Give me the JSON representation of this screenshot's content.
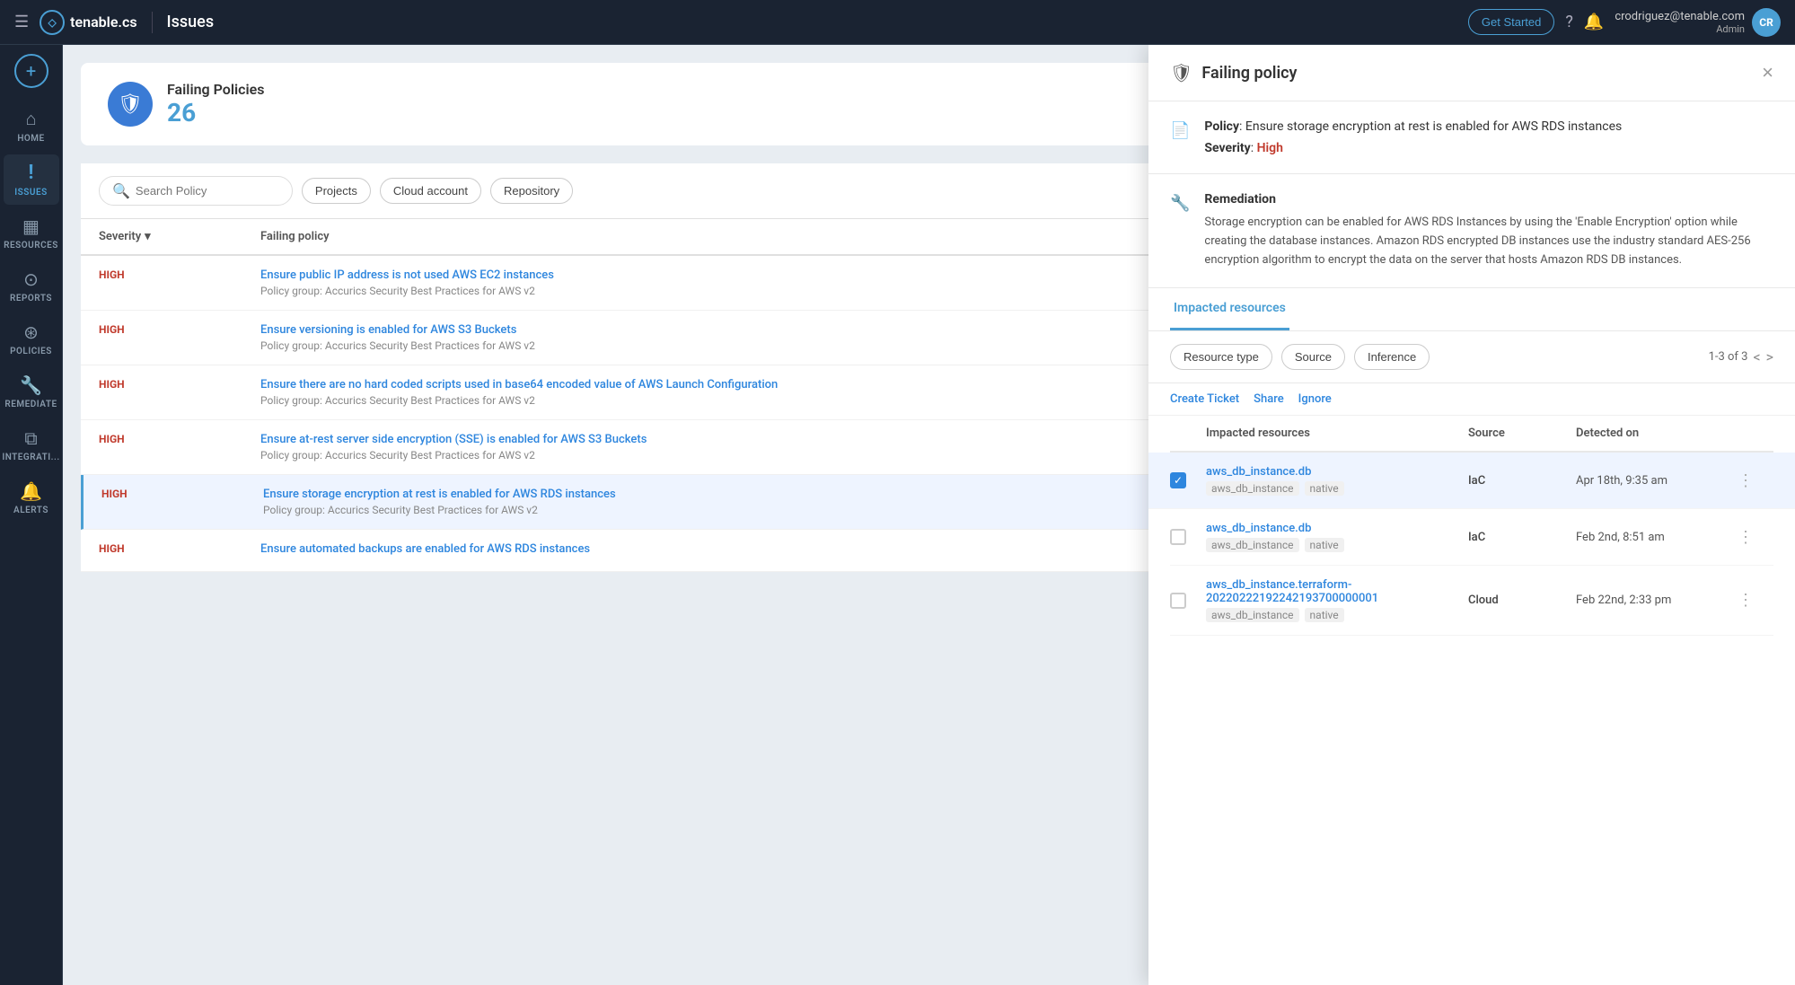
{
  "navbar": {
    "menu_icon": "☰",
    "logo_icon": "◇",
    "logo_text": "tenable.cs",
    "title": "Issues",
    "get_started": "Get Started",
    "help_icon": "?",
    "bell_icon": "🔔",
    "user_email": "crodriguez@tenable.com",
    "user_role": "Admin",
    "user_initials": "CR"
  },
  "sidebar": {
    "add_icon": "+",
    "items": [
      {
        "id": "home",
        "label": "HOME",
        "icon": "⌂",
        "active": false
      },
      {
        "id": "issues",
        "label": "ISSUES",
        "icon": "!",
        "active": true
      },
      {
        "id": "resources",
        "label": "RESOURCES",
        "icon": "▦",
        "active": false
      },
      {
        "id": "reports",
        "label": "REPORTS",
        "icon": "⊙",
        "active": false
      },
      {
        "id": "policies",
        "label": "POLICIES",
        "icon": "⊛",
        "active": false
      },
      {
        "id": "remediate",
        "label": "REMEDIATE",
        "icon": "🔧",
        "active": false
      },
      {
        "id": "integrations",
        "label": "INTEGRATI...",
        "icon": "⧉",
        "active": false
      },
      {
        "id": "alerts",
        "label": "ALERTS",
        "icon": "🔔",
        "active": false
      }
    ]
  },
  "issues": {
    "header": {
      "icon": "🛡",
      "title": "Failing Policies",
      "count": "26"
    },
    "toolbar": {
      "search_placeholder": "Search Policy",
      "filters": [
        "Projects",
        "Cloud account",
        "Repository"
      ]
    },
    "table_headers": {
      "severity": "Severity",
      "failing_policy": "Failing policy"
    },
    "rows": [
      {
        "severity": "HIGH",
        "policy": "Ensure public IP address is not used AWS EC2 instances",
        "group": "Policy group: Accurics Security Best Practices for AWS v2",
        "selected": false
      },
      {
        "severity": "HIGH",
        "policy": "Ensure versioning is enabled for AWS S3 Buckets",
        "group": "Policy group: Accurics Security Best Practices for AWS v2",
        "selected": false
      },
      {
        "severity": "HIGH",
        "policy": "Ensure there are no hard coded scripts used in base64 encoded value of AWS Launch Configuration",
        "group": "Policy group: Accurics Security Best Practices for AWS v2",
        "selected": false
      },
      {
        "severity": "HIGH",
        "policy": "Ensure at-rest server side encryption (SSE) is enabled for AWS S3 Buckets",
        "group": "Policy group: Accurics Security Best Practices for AWS v2",
        "selected": false
      },
      {
        "severity": "HIGH",
        "policy": "Ensure storage encryption at rest is enabled for AWS RDS instances",
        "group": "Policy group: Accurics Security Best Practices for AWS v2",
        "selected": true
      },
      {
        "severity": "HIGH",
        "policy": "Ensure automated backups are enabled for AWS RDS instances",
        "group": "",
        "selected": false
      }
    ]
  },
  "detail": {
    "header_icon": "🛡",
    "title": "Failing policy",
    "close_icon": "×",
    "policy_label": "Policy",
    "policy_text": "Ensure storage encryption at rest is enabled for AWS RDS instances",
    "severity_label": "Severity",
    "severity_value": "High",
    "remediation_label": "Remediation",
    "remediation_text": "Storage encryption can be enabled for AWS RDS Instances by using the 'Enable Encryption' option while creating the database instances. Amazon RDS encrypted DB instances use the industry standard AES-256 encryption algorithm to encrypt the data on the server that hosts Amazon RDS DB instances.",
    "tabs": [
      {
        "id": "impacted",
        "label": "Impacted resources",
        "active": true
      }
    ],
    "filters": {
      "resource_type": "Resource type",
      "source": "Source",
      "inference": "Inference"
    },
    "pagination": {
      "text": "1-3 of 3",
      "prev_icon": "<",
      "next_icon": ">"
    },
    "actions": {
      "create_ticket": "Create Ticket",
      "share": "Share",
      "ignore": "Ignore"
    },
    "table_headers": {
      "impacted_resources": "Impacted resources",
      "source": "Source",
      "detected_on": "Detected on"
    },
    "resources": [
      {
        "name": "aws_db_instance.db",
        "sub1": "aws_db_instance",
        "sub2": "native",
        "source": "IaC",
        "detected": "Apr 18th, 9:35 am",
        "checked": true
      },
      {
        "name": "aws_db_instance.db",
        "sub1": "aws_db_instance",
        "sub2": "native",
        "source": "IaC",
        "detected": "Feb 2nd, 8:51 am",
        "checked": false
      },
      {
        "name": "aws_db_instance.terraform-20220222192242193700000001",
        "sub1": "aws_db_instance",
        "sub2": "native",
        "source": "Cloud",
        "detected": "Feb 22nd, 2:33 pm",
        "checked": false
      }
    ]
  }
}
